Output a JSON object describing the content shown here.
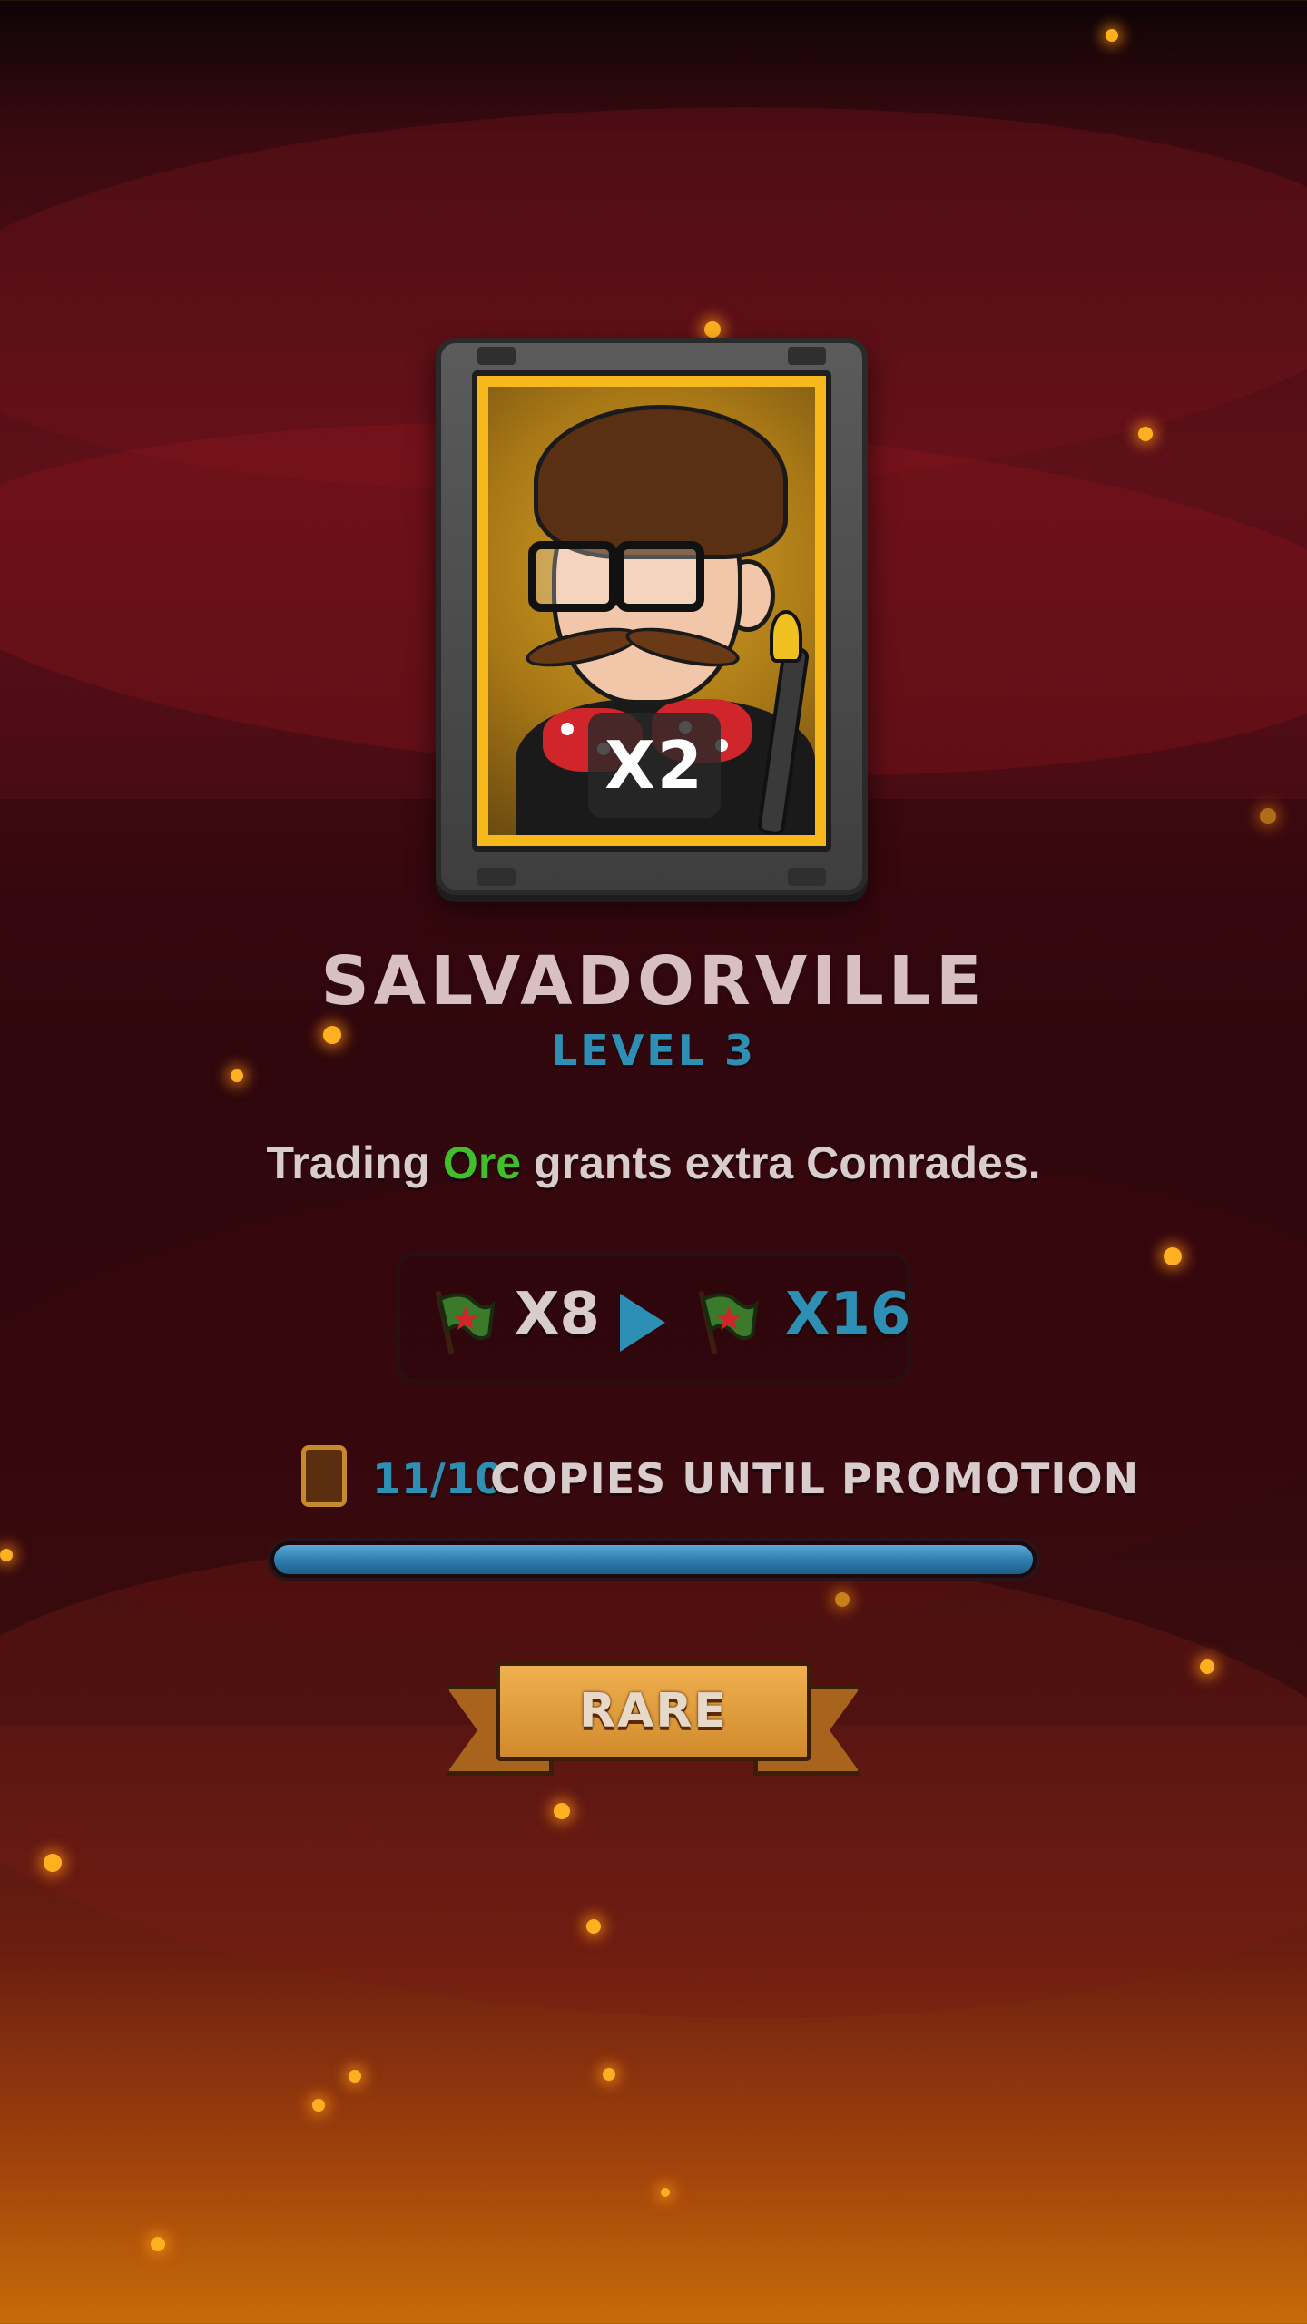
{
  "card": {
    "multiplier": "X2",
    "name": "SALVADORVILLE",
    "level": "LEVEL 3"
  },
  "description": {
    "before": "Trading ",
    "highlight": "Ore",
    "after": " grants extra Comrades."
  },
  "boost": {
    "icon": "flag-icon",
    "from": "X8",
    "to": "X16"
  },
  "copies": {
    "icon": "card-copy-icon",
    "count": "11/10",
    "label": "COPIES UNTIL PROMOTION",
    "progress_fraction": 1.0
  },
  "rarity": {
    "label": "RARE"
  },
  "colors": {
    "accent_blue": "#2e8fb4",
    "highlight_green": "#3fbf2a",
    "rarity_gold": "#f0b050"
  }
}
